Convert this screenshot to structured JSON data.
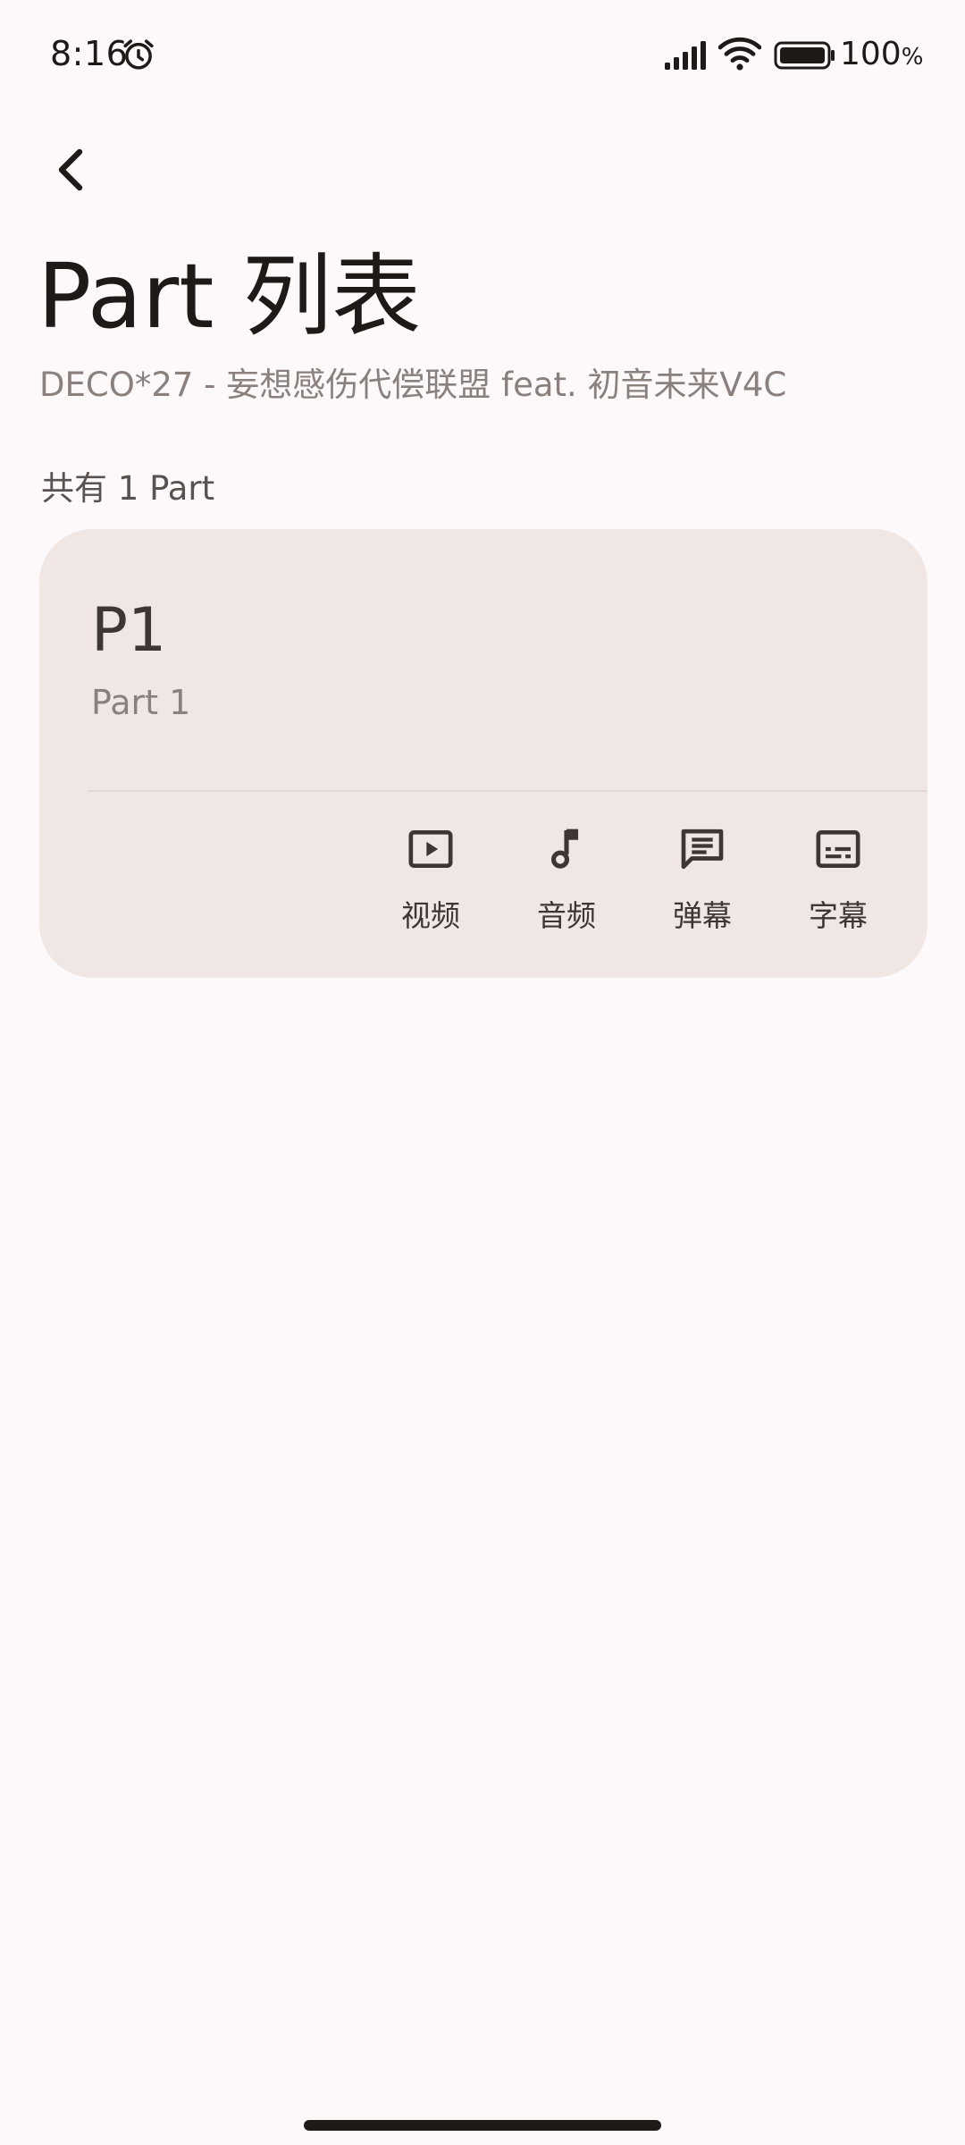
{
  "status_bar": {
    "time": "8:16",
    "battery": "100",
    "battery_unit": "%",
    "icons": [
      "alarm-icon",
      "signal-icon",
      "wifi-icon",
      "battery-icon"
    ]
  },
  "header": {
    "back_icon": "back-arrow-icon",
    "title": "Part 列表",
    "subtitle": "DECO*27 - 妄想感伤代偿联盟 feat. 初音未来V4C"
  },
  "summary": {
    "count_text": "共有 1 Part"
  },
  "parts": [
    {
      "name": "P1",
      "label": "Part 1",
      "actions": [
        {
          "label": "视频",
          "icon": "video-play-icon"
        },
        {
          "label": "音频",
          "icon": "music-note-icon"
        },
        {
          "label": "弹幕",
          "icon": "comment-icon"
        },
        {
          "label": "字幕",
          "icon": "subtitles-icon"
        }
      ]
    }
  ],
  "colors": {
    "background": "#FDF8FA",
    "card": "#F0E7E5",
    "text_primary": "#1E1A18",
    "text_secondary": "#8A817E"
  }
}
